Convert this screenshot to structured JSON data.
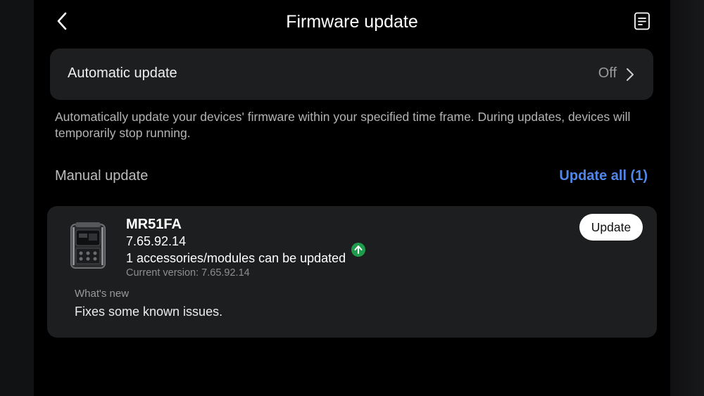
{
  "header": {
    "title": "Firmware update",
    "back_icon": "chevron-left-icon",
    "log_icon": "document-list-icon"
  },
  "automatic_update": {
    "label": "Automatic update",
    "status": "Off",
    "chevron_icon": "chevron-right-icon"
  },
  "description": "Automatically update your devices' firmware within your specified time frame. During updates, devices will temporarily stop running.",
  "manual_update": {
    "label": "Manual update",
    "update_all_label": "Update all (1)"
  },
  "device": {
    "name": "MR51FA",
    "version": "7.65.92.14",
    "accessories_text": "1 accessories/modules can be updated",
    "current_version": "Current version: 7.65.92.14",
    "whats_new_label": "What's new",
    "whats_new_text": "Fixes some known issues.",
    "update_label": "Update",
    "upgrade_icon": "upgrade-arrow-icon",
    "upgrade_icon_color": "#1e9b4b"
  },
  "colors": {
    "accent": "#4f86e8",
    "card": "#1d1e20",
    "background": "#000000"
  }
}
